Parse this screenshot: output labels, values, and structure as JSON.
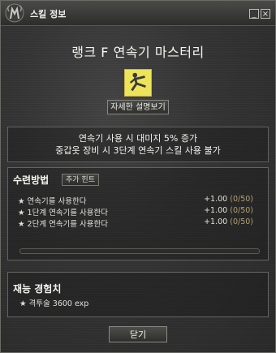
{
  "window": {
    "title": "스킬 정보",
    "minimize_label": "_",
    "close_label": "×"
  },
  "skill": {
    "name": "랭크 F 연속기 마스터리",
    "icon": "kick-martial-artist-icon",
    "detail_button": "자세한 설명보기",
    "effect_line1": "연속기 사용 시 대미지 5% 증가",
    "effect_line2": "중갑옷 장비 시 3단계 연속기 스킬 사용 불가"
  },
  "training": {
    "title": "수련방법",
    "hint_button": "추가 힌트",
    "items": [
      {
        "label": "★ 연속기를 사용한다",
        "value": "+1.00",
        "progress": "(0/50)"
      },
      {
        "label": "★ 1단계 연속기를 사용한다",
        "value": "+1.00",
        "progress": "(0/50)"
      },
      {
        "label": "★ 2단계 연속기를 사용한다",
        "value": "+1.00",
        "progress": "(0/50)"
      }
    ]
  },
  "talent": {
    "title": "재능 경험치",
    "item": "★ 격투술 3600 exp"
  },
  "footer": {
    "close_button": "닫기"
  },
  "colors": {
    "background": "#353535",
    "accent_progress": "#b0a070",
    "icon_yellow": "#f7ee6a"
  }
}
